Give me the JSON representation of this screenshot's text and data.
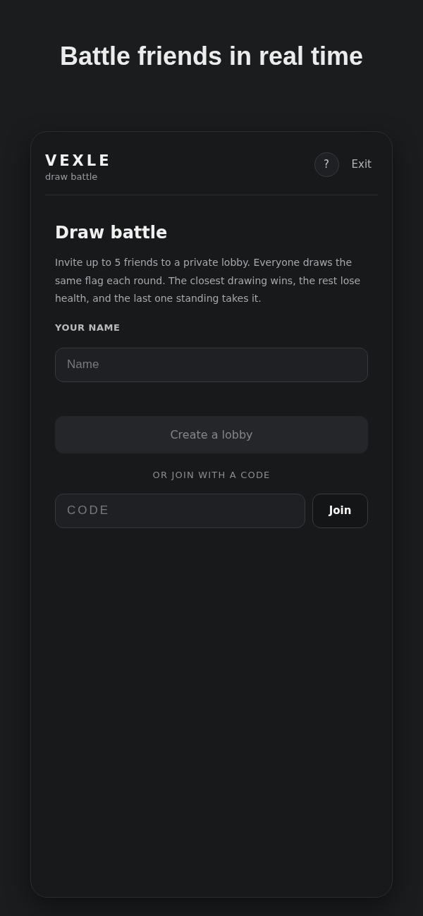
{
  "headline": "Battle friends in real time",
  "header": {
    "logo": "VEXLE",
    "tagline": "draw battle",
    "help_button": "?",
    "exit_link": "Exit"
  },
  "intro": {
    "title": "Draw battle",
    "text": "Invite up to 5 friends to a private lobby. Everyone draws the same flag each round. The closest drawing wins, the rest lose health, and the last one standing takes it."
  },
  "name_field": {
    "label": "YOUR NAME",
    "placeholder": "Name"
  },
  "create_button": {
    "label": "Create a lobby",
    "disabled": true
  },
  "join": {
    "divider_label": "OR JOIN WITH A CODE",
    "code_field": {
      "placeholder": "CODE"
    },
    "button": "Join"
  }
}
